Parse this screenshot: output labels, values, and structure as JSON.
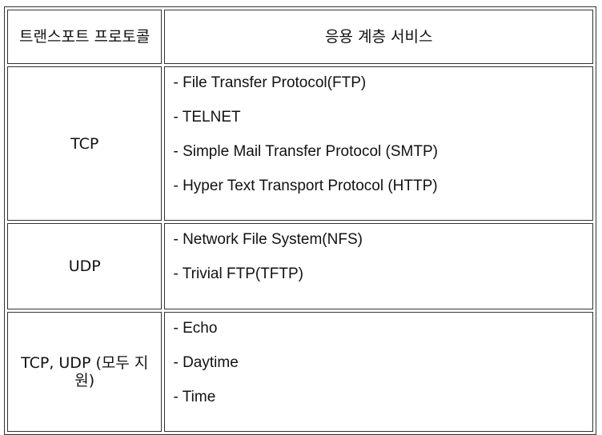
{
  "table": {
    "header": {
      "transport_protocol": "트랜스포트 프로토콜",
      "application_services": "응용 계층 서비스"
    },
    "rows": [
      {
        "protocol": "TCP",
        "services": [
          "- File Transfer Protocol(FTP)",
          "- TELNET",
          "- Simple Mail Transfer Protocol (SMTP)",
          "- Hyper Text Transport Protocol (HTTP)"
        ]
      },
      {
        "protocol": "UDP",
        "services": [
          "- Network File System(NFS)",
          "- Trivial FTP(TFTP)"
        ]
      },
      {
        "protocol": "TCP, UDP (모두 지원)",
        "services": [
          "- Echo",
          "- Daytime",
          "- Time"
        ]
      }
    ]
  }
}
